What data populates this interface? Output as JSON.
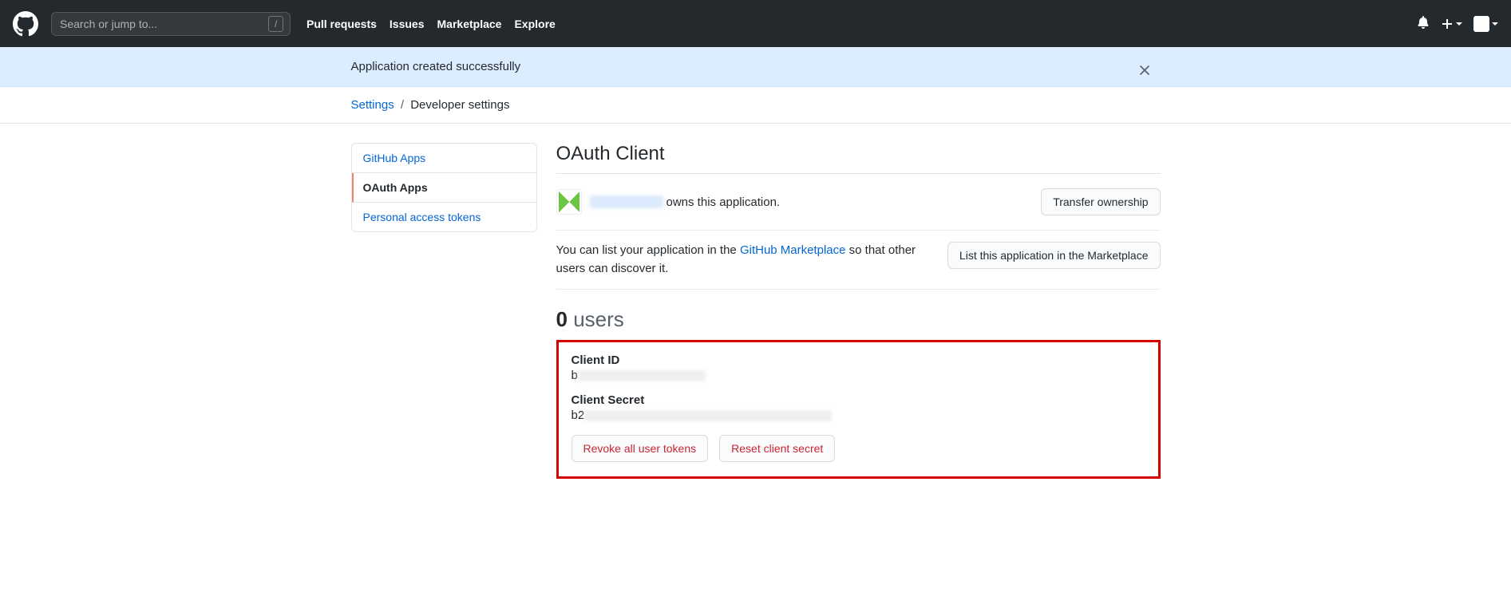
{
  "header": {
    "search_placeholder": "Search or jump to...",
    "slash_hint": "/",
    "nav": [
      "Pull requests",
      "Issues",
      "Marketplace",
      "Explore"
    ]
  },
  "flash": {
    "message": "Application created successfully"
  },
  "breadcrumb": {
    "root": "Settings",
    "separator": "/",
    "current": "Developer settings"
  },
  "sidebar": {
    "items": [
      {
        "label": "GitHub Apps",
        "active": false
      },
      {
        "label": "OAuth Apps",
        "active": true
      },
      {
        "label": "Personal access tokens",
        "active": false
      }
    ]
  },
  "page": {
    "title": "OAuth Client",
    "owner_suffix": "owns this application.",
    "transfer_btn": "Transfer ownership",
    "market_text_pre": "You can list your application in the ",
    "market_link": "GitHub Marketplace",
    "market_text_post": " so that other users can discover it.",
    "market_btn": "List this application in the Marketplace",
    "users_count": "0",
    "users_label": "users",
    "client_id_label": "Client ID",
    "client_id_prefix": "b",
    "client_secret_label": "Client Secret",
    "client_secret_prefix": "b2",
    "revoke_btn": "Revoke all user tokens",
    "reset_btn": "Reset client secret"
  }
}
